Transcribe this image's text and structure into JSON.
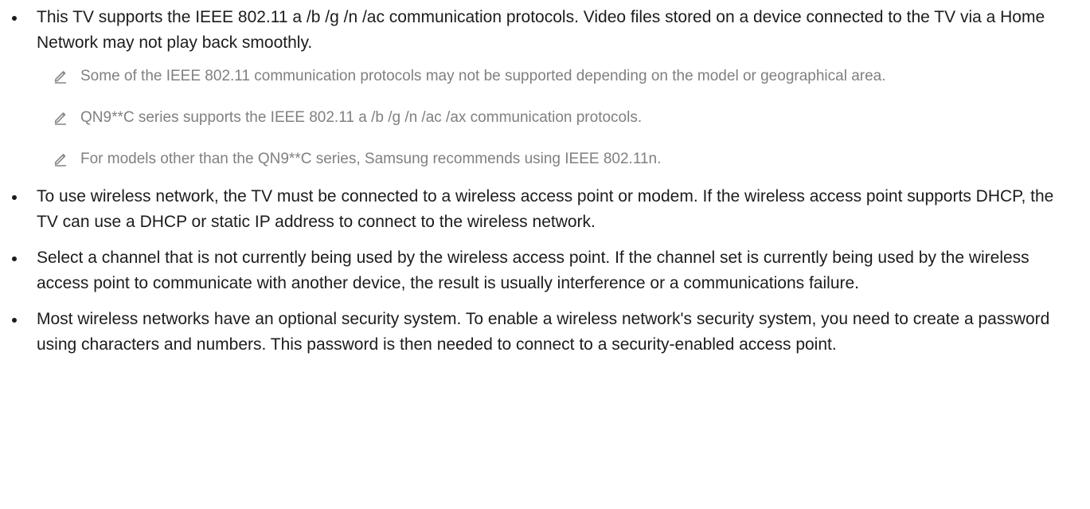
{
  "bullets": [
    {
      "text": "This TV supports the IEEE 802.11 a /b /g /n /ac communication protocols. Video files stored on a device connected to the TV via a Home Network may not play back smoothly.",
      "notes": [
        {
          "icon": "pencil-note-icon",
          "text": "Some of the IEEE 802.11 communication protocols may not be supported depending on the model or geographical area."
        },
        {
          "icon": "pencil-note-icon",
          "text": "QN9**C series supports the IEEE 802.11 a /b /g /n /ac /ax communication protocols."
        },
        {
          "icon": "pencil-note-icon",
          "text": "For models other than the QN9**C series, Samsung recommends using IEEE 802.11n."
        }
      ]
    },
    {
      "text": "To use wireless network, the TV must be connected to a wireless access point or modem. If the wireless access point supports DHCP, the TV can use a DHCP or static IP address to connect to the wireless network."
    },
    {
      "text": "Select a channel that is not currently being used by the wireless access point. If the channel set is currently being used by the wireless access point to communicate with another device, the result is usually interference or a communications failure."
    },
    {
      "text": "Most wireless networks have an optional security system. To enable a wireless network's security system, you need to create a password using characters and numbers. This password is then needed to connect to a security-enabled access point."
    }
  ],
  "colors": {
    "body_text": "#1c1c1c",
    "note_text": "#808080",
    "note_icon": "#8a8a8a"
  }
}
